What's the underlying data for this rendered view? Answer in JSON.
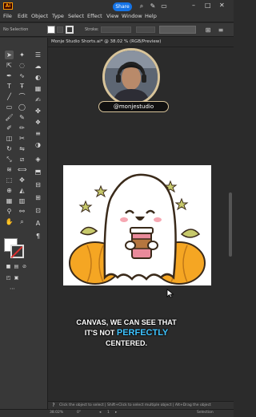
{
  "titlebar": {
    "app_logo": "Ai",
    "share_label": "Share",
    "icons": [
      "search-icon",
      "pen-icon",
      "tabs-icon"
    ]
  },
  "menubar": {
    "items": [
      "File",
      "Edit",
      "Object",
      "Type",
      "Select",
      "Effect",
      "View",
      "Window",
      "Help"
    ]
  },
  "controlbar": {
    "selection_label": "No Selection",
    "stroke_label": "Stroke:"
  },
  "document": {
    "tab_title": "Monje Studio Shorts.ai* @ 38.02 % (RGB/Preview)",
    "close_label": "×"
  },
  "overlay": {
    "handle": "@monjestudio"
  },
  "caption": {
    "line1": "CANVAS, WE CAN SEE THAT",
    "line2_pre": "IT'S NOT",
    "line2_highlight": "PERFECTLY",
    "line3": "CENTERED."
  },
  "hintbar": {
    "text": "Click the object to select  |  Shift+Click to select multiple object  |  Alt+Drag the object"
  },
  "statusbar": {
    "zoom": "38.02%",
    "angle": "0°",
    "page": "1",
    "mode": "Selection"
  },
  "colors": {
    "accent": "#1473e6",
    "caption_highlight": "#3ec3ff",
    "ghost_cup": "#e98a9a",
    "pumpkin": "#f5a623",
    "leaf": "#c7c96b"
  }
}
